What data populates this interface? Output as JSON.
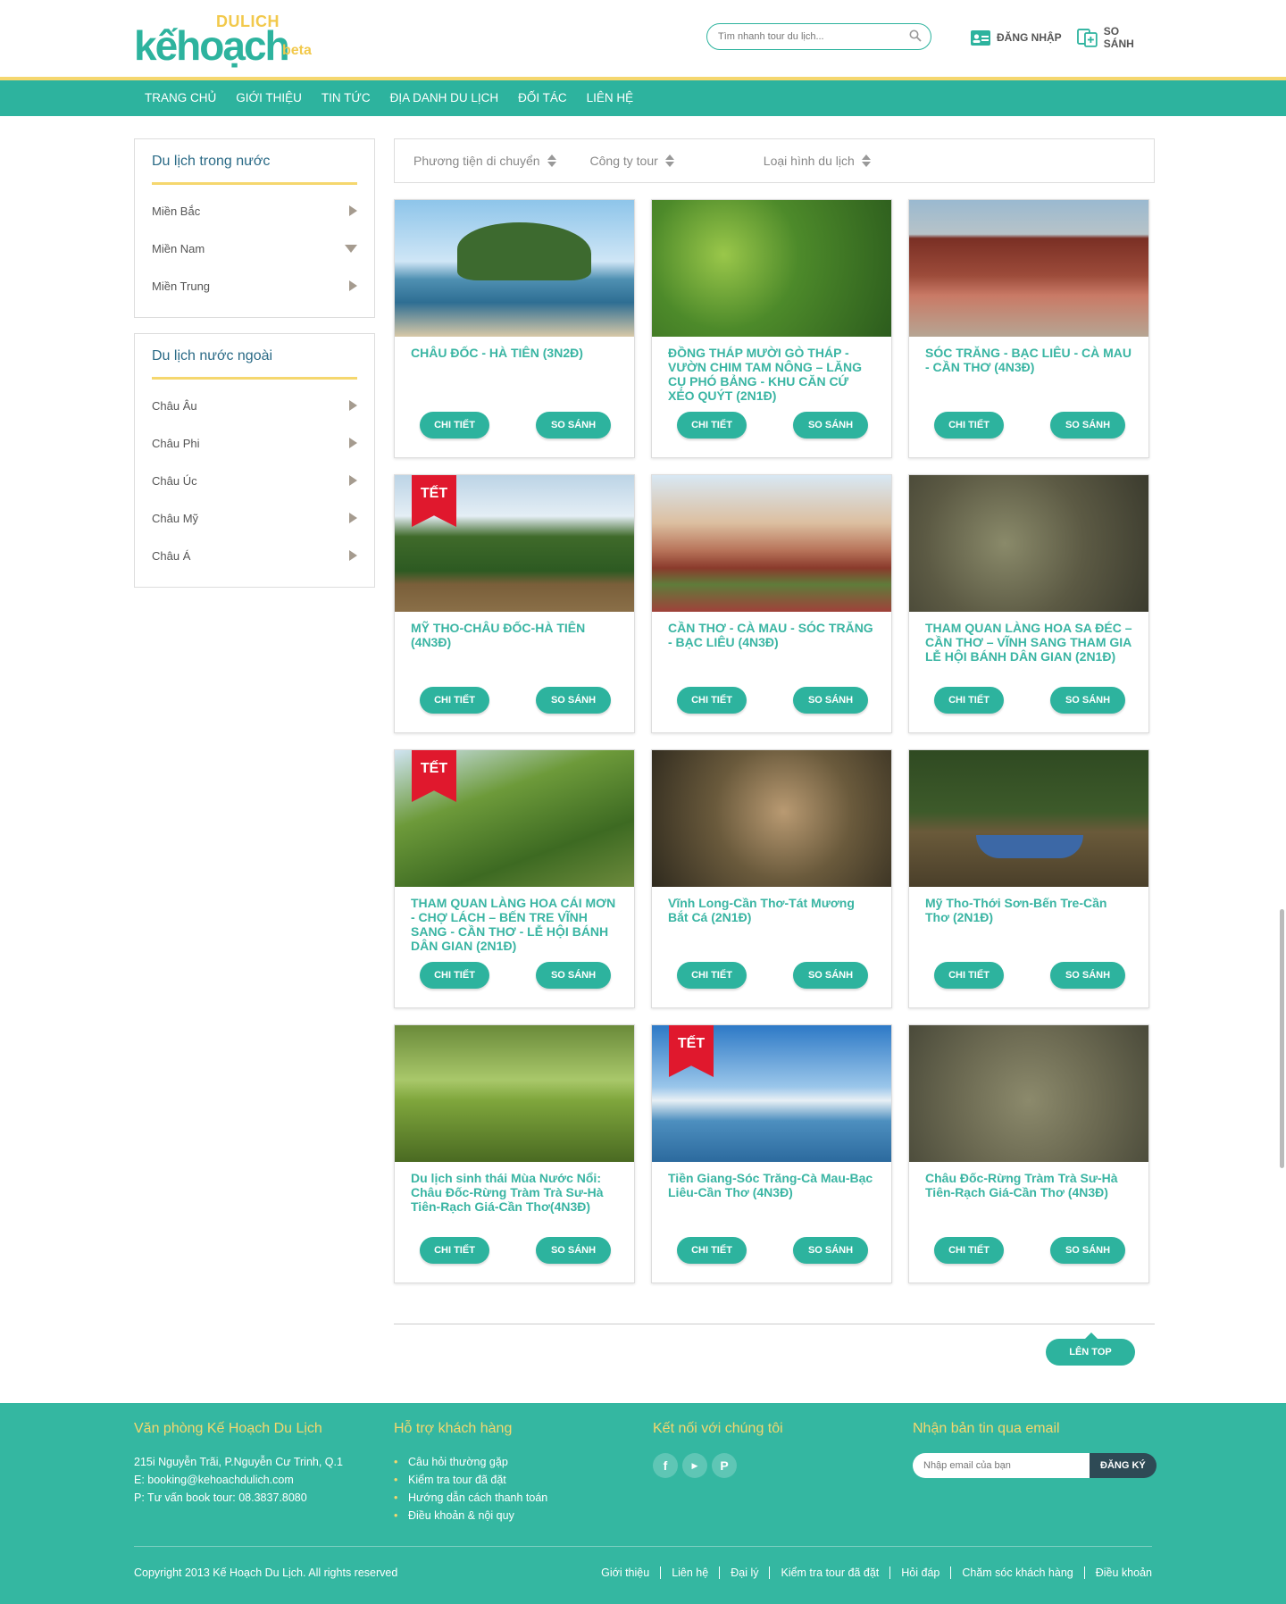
{
  "header": {
    "logo_top": "DULICH",
    "logo_main": "kếhoạch",
    "logo_tag": "beta",
    "search_placeholder": "Tìm nhanh tour du lịch...",
    "login_label": "ĐĂNG NHẬP",
    "compare_label": "SO SÁNH"
  },
  "nav": [
    "TRANG CHỦ",
    "GIỚI THIỆU",
    "TIN TỨC",
    "ĐỊA DANH DU LỊCH",
    "ĐỐI TÁC",
    "LIÊN HỆ"
  ],
  "sidebar": {
    "domestic": {
      "title": "Du lịch trong nước",
      "items": [
        {
          "label": "Miền Bắc",
          "state": "collapsed"
        },
        {
          "label": "Miền Nam",
          "state": "expanded"
        },
        {
          "label": "Miền Trung",
          "state": "collapsed"
        }
      ]
    },
    "foreign": {
      "title": "Du lịch nước ngoài",
      "items": [
        {
          "label": "Châu Âu"
        },
        {
          "label": "Châu Phi"
        },
        {
          "label": "Châu Úc"
        },
        {
          "label": "Châu Mỹ"
        },
        {
          "label": "Châu Á"
        }
      ]
    }
  },
  "filters": [
    "Phương tiện di chuyển",
    "Công ty tour",
    "Loại hình du lịch"
  ],
  "buttons": {
    "detail": "CHI TIẾT",
    "compare": "SO SÁNH",
    "top": "LÊN TOP"
  },
  "ribbon_label": "TẾT",
  "tours": [
    {
      "title": "CHÂU ĐỐC - HÀ TIÊN (3N2Đ)",
      "tet": false
    },
    {
      "title": "ĐỒNG THÁP MƯỜI GÒ THÁP - VƯỜN CHIM TAM NÔNG – LĂNG CỤ PHÓ BẢNG - KHU CĂN CỨ XẺO QUÝT (2N1Đ)",
      "tet": false
    },
    {
      "title": "SÓC TRĂNG - BẠC LIÊU - CÀ MAU - CẦN THƠ (4N3Đ)",
      "tet": false
    },
    {
      "title": "MỸ THO-CHÂU ĐỐC-HÀ TIÊN (4N3Đ)",
      "tet": true
    },
    {
      "title": "CẦN THƠ - CÀ MAU - SÓC TRĂNG - BẠC LIÊU (4N3Đ)",
      "tet": false
    },
    {
      "title": "THAM QUAN LÀNG HOA SA ĐÉC – CẦN THƠ – VĨNH SANG THAM GIA LỄ HỘI BÁNH DÂN GIAN (2N1Đ)",
      "tet": false
    },
    {
      "title": "THAM QUAN LÀNG HOA CÁI MƠN - CHỢ LÁCH – BẾN TRE VĨNH SANG - CẦN THƠ - LỄ HỘI BÁNH DÂN GIAN (2N1Đ)",
      "tet": true
    },
    {
      "title": "Vĩnh Long-Cần Thơ-Tát Mương Bắt Cá (2N1Đ)",
      "tet": false
    },
    {
      "title": "Mỹ Tho-Thới Sơn-Bến Tre-Cần Thơ (2N1Đ)",
      "tet": false
    },
    {
      "title": "Du lịch sinh thái Mùa Nước Nổi: Châu Đốc-Rừng Tràm Trà Sư-Hà Tiên-Rạch Giá-Cần Thơ(4N3Đ)",
      "tet": false
    },
    {
      "title": "Tiền Giang-Sóc Trăng-Cà Mau-Bạc Liêu-Cần Thơ (4N3Đ)",
      "tet": true
    },
    {
      "title": "Châu Đốc-Rừng Tràm Trà Sư-Hà Tiên-Rạch Giá-Cần Thơ (4N3Đ)",
      "tet": false
    }
  ],
  "footer": {
    "office": {
      "title": "Văn phòng Kế Hoạch Du Lịch",
      "address": "215i Nguyễn Trãi, P.Nguyễn Cư Trinh, Q.1",
      "email": "E: booking@kehoachdulich.com",
      "phone": "P: Tư vấn book tour: 08.3837.8080"
    },
    "support": {
      "title": "Hỗ trợ khách hàng",
      "items": [
        "Câu hỏi thường gặp",
        "Kiểm tra tour đã đặt",
        "Hướng dẫn cách thanh toán",
        "Điều khoản & nội quy"
      ]
    },
    "social": {
      "title": "Kết nối với chúng tôi",
      "icons": [
        "facebook-icon",
        "youtube-icon",
        "pinterest-icon"
      ]
    },
    "newsletter": {
      "title": "Nhận bản tin qua email",
      "placeholder": "Nhập email của bạn",
      "button": "ĐĂNG KÝ"
    },
    "copyright": "Copyright 2013 Kế Hoạch Du Lịch. All rights reserved",
    "links": [
      "Giới thiệu",
      "Liên hệ",
      "Đại lý",
      "Kiểm tra tour đã đặt",
      "Hỏi đáp",
      "Chăm sóc khách hàng",
      "Điều khoản"
    ]
  },
  "colors": {
    "accent": "#2db39e",
    "highlight": "#f5d76e",
    "ribbon": "#e0182d"
  }
}
